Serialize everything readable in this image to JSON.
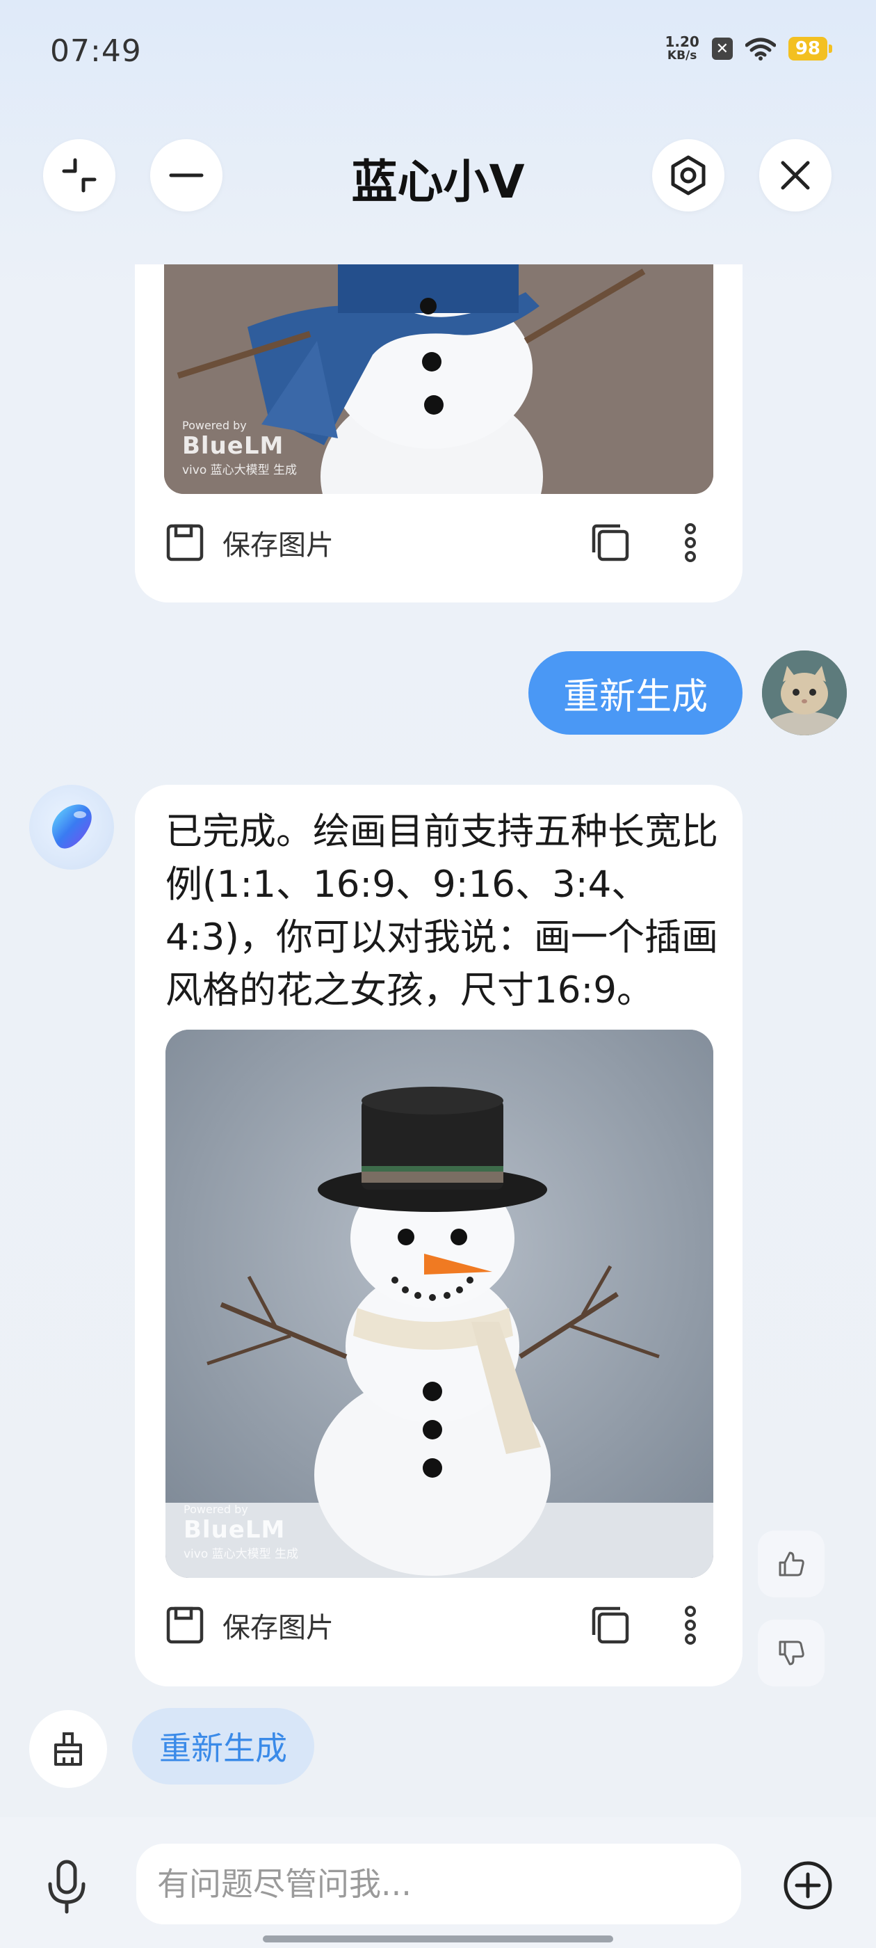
{
  "status": {
    "time": "07:49",
    "net_speed_value": "1.20",
    "net_speed_unit": "KB/s",
    "battery": "98"
  },
  "header": {
    "title": "蓝心小V"
  },
  "messages": {
    "save_image_label": "保存图片",
    "user_message": "重新生成",
    "ai_text": "已完成。绘画目前支持五种长宽比例(1:1、16:9、9:16、3:4、4:3)，你可以对我说：画一个插画风格的花之女孩，尺寸16:9。",
    "watermark": {
      "powered": "Powered by",
      "brand": "BlueLM",
      "sub": "vivo 蓝心大模型 生成"
    }
  },
  "suggestion": {
    "regenerate_label": "重新生成"
  },
  "composer": {
    "placeholder": "有问题尽管问我..."
  },
  "colors": {
    "accent": "#4a98f5",
    "chip_bg": "#d8e6f8"
  }
}
